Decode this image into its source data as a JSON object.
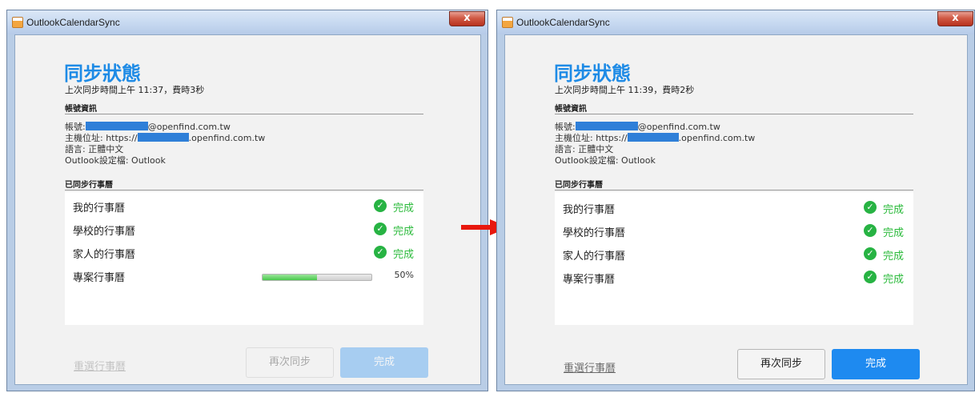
{
  "left": {
    "window_title": "OutlookCalendarSync",
    "close_label": "x",
    "heading": "同步狀態",
    "subline": "上次同步時間上午 11:37，費時3秒",
    "account_section": "帳號資訊",
    "account_label": "帳號:",
    "account_suffix": "@openfind.com.tw",
    "host_label": "主機位址: https://",
    "host_suffix": ".openfind.com.tw",
    "language": "語言: 正體中文",
    "profile": "Outlook設定檔: Outlook",
    "synced_section": "已同步行事曆",
    "calendars": [
      {
        "name": "我的行事曆",
        "status": "完成"
      },
      {
        "name": "學校的行事曆",
        "status": "完成"
      },
      {
        "name": "家人的行事曆",
        "status": "完成"
      },
      {
        "name": "專案行事曆",
        "progress": 50,
        "progress_label": "50%"
      }
    ],
    "reselect_label": "重選行事曆",
    "sync_again_label": "再次同步",
    "done_label": "完成"
  },
  "right": {
    "window_title": "OutlookCalendarSync",
    "close_label": "x",
    "heading": "同步狀態",
    "subline": "上次同步時間上午 11:39，費時2秒",
    "account_section": "帳號資訊",
    "account_label": "帳號:",
    "account_suffix": "@openfind.com.tw",
    "host_label": "主機位址: https://",
    "host_suffix": ".openfind.com.tw",
    "language": "語言: 正體中文",
    "profile": "Outlook設定檔: Outlook",
    "synced_section": "已同步行事曆",
    "calendars": [
      {
        "name": "我的行事曆",
        "status": "完成"
      },
      {
        "name": "學校的行事曆",
        "status": "完成"
      },
      {
        "name": "家人的行事曆",
        "status": "完成"
      },
      {
        "name": "專案行事曆",
        "status": "完成"
      }
    ],
    "reselect_label": "重選行事曆",
    "sync_again_label": "再次同步",
    "done_label": "完成"
  },
  "colors": {
    "accent": "#1e8af0",
    "heading": "#1e8be6",
    "success": "#2dbb3d",
    "arrow": "#e8180e"
  },
  "icons": {
    "check": "check-circle-icon",
    "arrow": "right-arrow-icon"
  }
}
